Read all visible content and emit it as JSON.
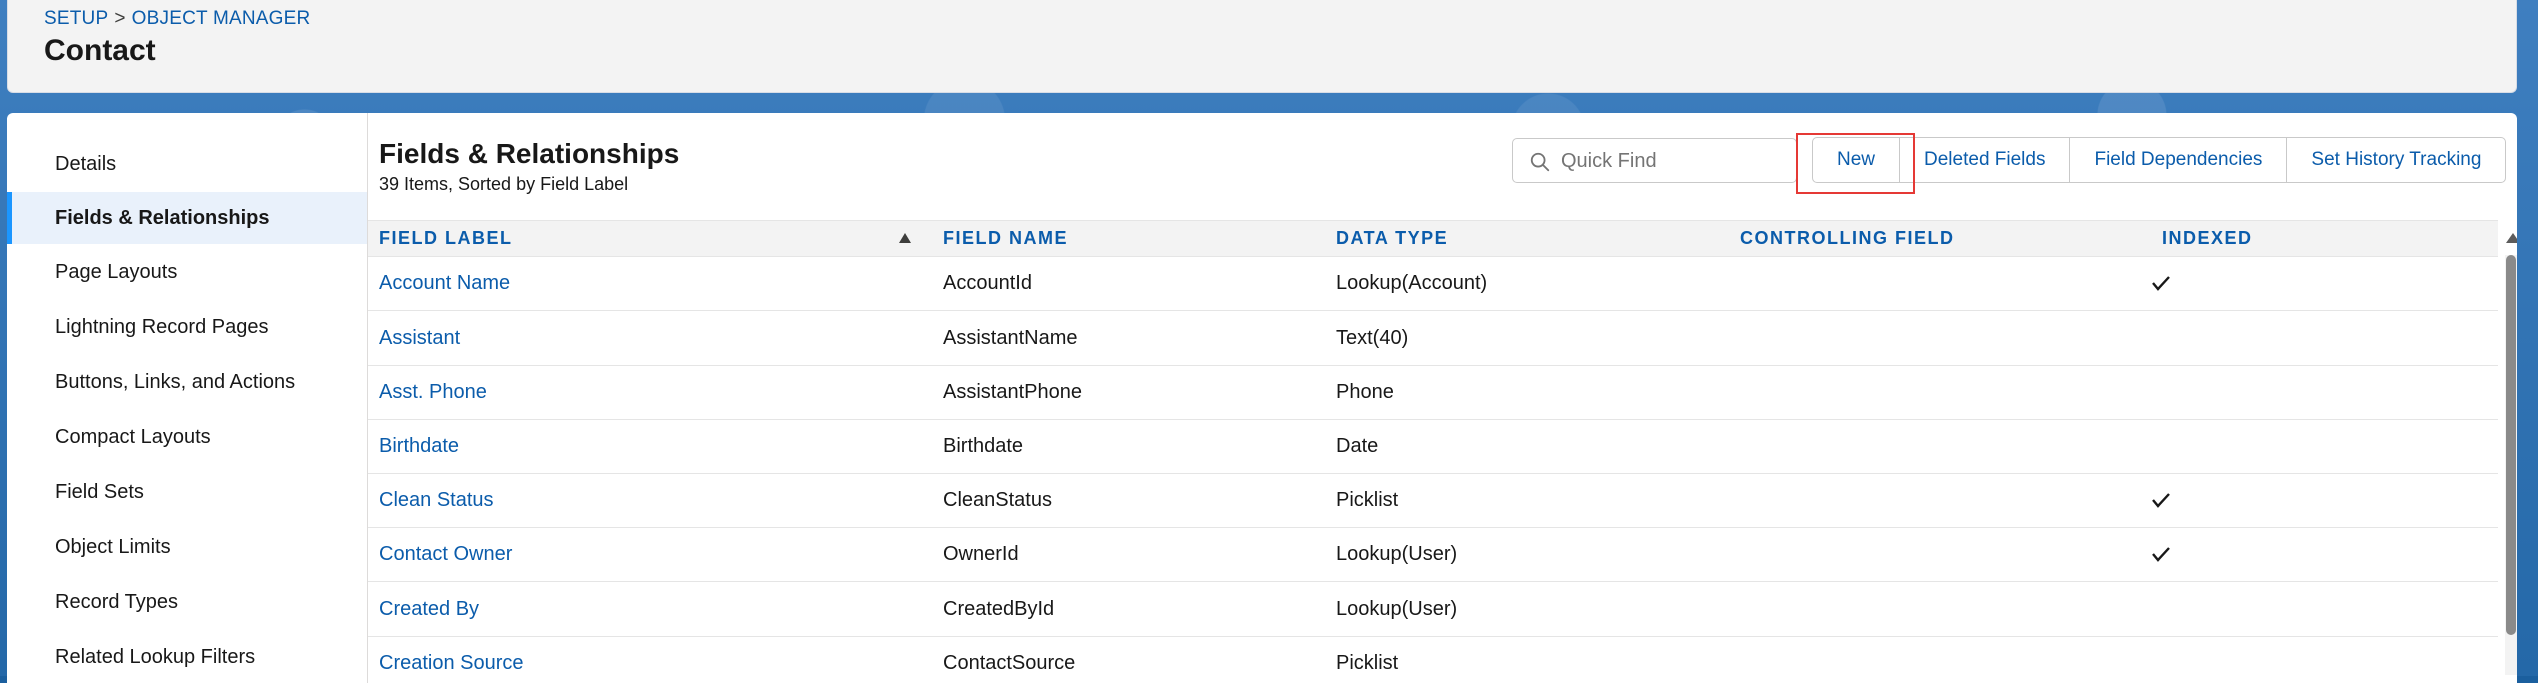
{
  "header": {
    "breadcrumb": [
      "SETUP",
      "OBJECT MANAGER"
    ],
    "breadcrumb_sep": ">",
    "title": "Contact"
  },
  "sidebar": {
    "items": [
      {
        "label": "Details",
        "active": false
      },
      {
        "label": "Fields & Relationships",
        "active": true
      },
      {
        "label": "Page Layouts",
        "active": false
      },
      {
        "label": "Lightning Record Pages",
        "active": false
      },
      {
        "label": "Buttons, Links, and Actions",
        "active": false
      },
      {
        "label": "Compact Layouts",
        "active": false
      },
      {
        "label": "Field Sets",
        "active": false
      },
      {
        "label": "Object Limits",
        "active": false
      },
      {
        "label": "Record Types",
        "active": false
      },
      {
        "label": "Related Lookup Filters",
        "active": false
      }
    ]
  },
  "section": {
    "title": "Fields & Relationships",
    "subtitle": "39 Items, Sorted by Field Label"
  },
  "search": {
    "placeholder": "Quick Find",
    "value": ""
  },
  "buttons": {
    "new": "New",
    "deleted_fields": "Deleted Fields",
    "field_dependencies": "Field Dependencies",
    "set_history_tracking": "Set History Tracking"
  },
  "table": {
    "columns": [
      "FIELD LABEL",
      "FIELD NAME",
      "DATA TYPE",
      "CONTROLLING FIELD",
      "INDEXED"
    ],
    "sorted_by": "FIELD LABEL",
    "sort_direction": "ascending",
    "rows": [
      {
        "label": "Account Name",
        "name": "AccountId",
        "type": "Lookup(Account)",
        "controlling": "",
        "indexed": true
      },
      {
        "label": "Assistant",
        "name": "AssistantName",
        "type": "Text(40)",
        "controlling": "",
        "indexed": false
      },
      {
        "label": "Asst. Phone",
        "name": "AssistantPhone",
        "type": "Phone",
        "controlling": "",
        "indexed": false
      },
      {
        "label": "Birthdate",
        "name": "Birthdate",
        "type": "Date",
        "controlling": "",
        "indexed": false
      },
      {
        "label": "Clean Status",
        "name": "CleanStatus",
        "type": "Picklist",
        "controlling": "",
        "indexed": true
      },
      {
        "label": "Contact Owner",
        "name": "OwnerId",
        "type": "Lookup(User)",
        "controlling": "",
        "indexed": true
      },
      {
        "label": "Created By",
        "name": "CreatedById",
        "type": "Lookup(User)",
        "controlling": "",
        "indexed": false
      },
      {
        "label": "Creation Source",
        "name": "ContactSource",
        "type": "Picklist",
        "controlling": "",
        "indexed": false
      }
    ]
  },
  "colors": {
    "link": "#0b5cab",
    "active_accent": "#1b96ff",
    "highlight": "#e53935",
    "header_bg": "#f3f3f3"
  },
  "icons": {
    "search": "search-icon",
    "sort": "sort-ascending-icon",
    "indexed": "checkmark-icon"
  }
}
